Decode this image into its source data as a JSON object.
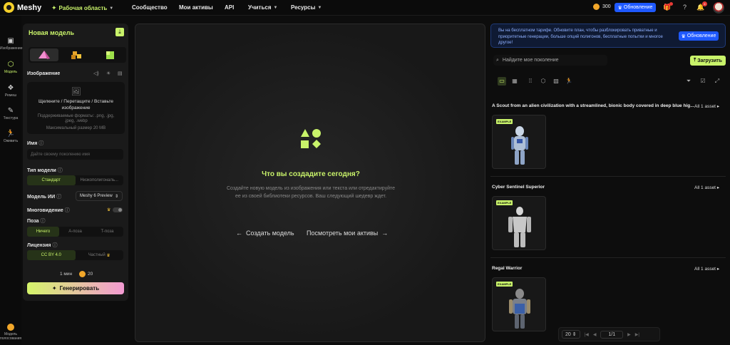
{
  "app": {
    "name": "Meshy"
  },
  "nav": {
    "workspace": "Рабочая область",
    "items": [
      "Сообщество",
      "Мои активы",
      "API",
      "Учиться",
      "Ресурсы"
    ]
  },
  "top": {
    "credits": "300",
    "upgrade": "Обновление",
    "notifications": "4"
  },
  "rail": {
    "items": [
      "Изображение",
      "Модель",
      "Ремеш",
      "Текстура",
      "Оживить"
    ],
    "bottom": "Модель полосования"
  },
  "panel": {
    "title": "Новая модель",
    "image_label": "Изображение",
    "upload_main": "Щелкните / Перетащите / Вставьте изображение",
    "upload_formats": "Поддерживаемые форматы: .png, .jpg, .jpeg, .webp",
    "upload_max": "Максимальный размер 20 MB",
    "name_label": "Имя",
    "name_placeholder": "Дайте своему поколению имя",
    "type_label": "Тип модели",
    "type_options": [
      "Стандарт",
      "Низкополигональ..."
    ],
    "ai_label": "Модель ИИ",
    "ai_value": "Meshy 6 Preview",
    "multiview_label": "Многовидение",
    "pose_label": "Поза",
    "pose_options": [
      "Ничего",
      "A-поза",
      "T-поза"
    ],
    "license_label": "Лицензия",
    "license_options": [
      "CC BY 4.0",
      "Частный"
    ],
    "time": "1 мин",
    "cost": "20",
    "generate": "Генерировать"
  },
  "canvas": {
    "title": "Что вы создадите сегодня?",
    "description": "Создайте новую модель из изображения или текста или отредактируйте ее из своей библиотеки ресурсов. Ваш следующий шедевр ждет.",
    "create": "Создать модель",
    "view_assets": "Посмотреть мои активы"
  },
  "right": {
    "banner": "Вы на бесплатном тарифе. Обновите план, чтобы разблокировать приватные и приоритетные генерации, больше опций полигонов, бесплатные попытки и многое другое!",
    "banner_btn": "Обновление",
    "search_placeholder": "Найдите мое поколение",
    "upload": "Загрузить",
    "groups": [
      {
        "title": "A Scout from an alien civilization with a streamlined, bionic body covered in deep blue hig...",
        "count": "All 1 asset",
        "tag": "EXAMPLE"
      },
      {
        "title": "Cyber Sentinel Superior",
        "count": "All 1 asset",
        "tag": "EXAMPLE"
      },
      {
        "title": "Regal Warrior",
        "count": "All 1 asset",
        "tag": "EXAMPLE"
      }
    ],
    "pager": {
      "size": "20",
      "page": "1/1"
    }
  }
}
